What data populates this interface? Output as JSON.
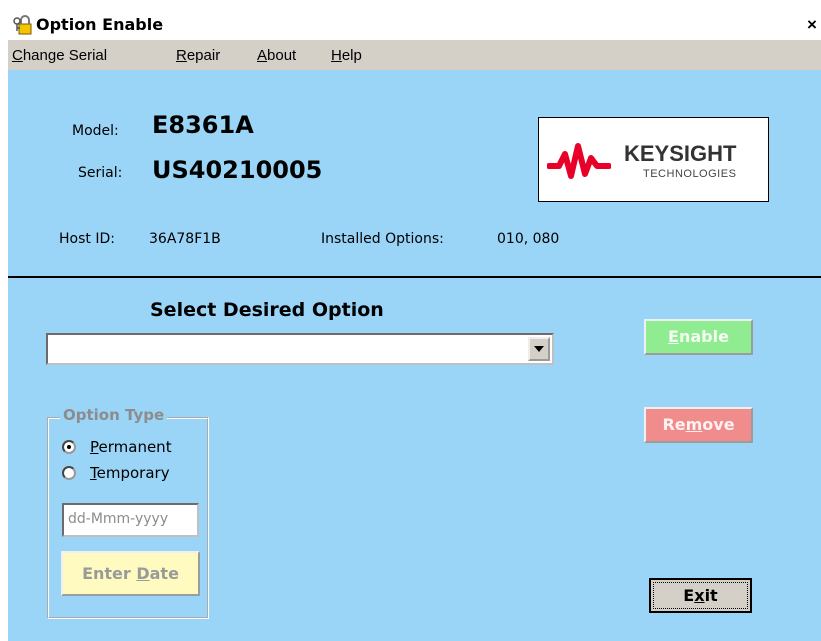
{
  "window": {
    "title": "Option Enable",
    "close_glyph": "×"
  },
  "menu": [
    {
      "pre": "",
      "ul": "C",
      "post": "hange Serial"
    },
    {
      "pre": "",
      "ul": "R",
      "post": "epair"
    },
    {
      "pre": "",
      "ul": "A",
      "post": "bout"
    },
    {
      "pre": "",
      "ul": "H",
      "post": "elp"
    }
  ],
  "info": {
    "model_label": "Model:",
    "model_value": "E8361A",
    "serial_label": "Serial:",
    "serial_value": "US40210005",
    "hostid_label": "Host ID:",
    "hostid_value": "36A78F1B",
    "installed_label": "Installed Options:",
    "installed_value": "010, 080"
  },
  "logo": {
    "line1": "KEYSIGHT",
    "line2": "TECHNOLOGIES",
    "color": "#e90029"
  },
  "select": {
    "title": "Select Desired Option",
    "value": ""
  },
  "buttons": {
    "enable": {
      "ul": "E",
      "post": "nable"
    },
    "remove": {
      "pre": "Re",
      "ul": "m",
      "post": "ove"
    },
    "exit": {
      "pre": "E",
      "ul": "x",
      "post": "it"
    },
    "enter_date": {
      "pre": "Enter ",
      "ul": "D",
      "post": "ate"
    }
  },
  "option_type": {
    "title": "Option Type",
    "permanent": {
      "ul": "P",
      "post": "ermanent",
      "selected": true
    },
    "temporary": {
      "ul": "T",
      "post": "emporary",
      "selected": false
    },
    "date_placeholder": "dd-Mmm-yyyy"
  },
  "colors": {
    "background": "#9ad5f7",
    "enable": "#90ec90",
    "remove": "#f08c8c",
    "enter_date": "#fffac0"
  }
}
